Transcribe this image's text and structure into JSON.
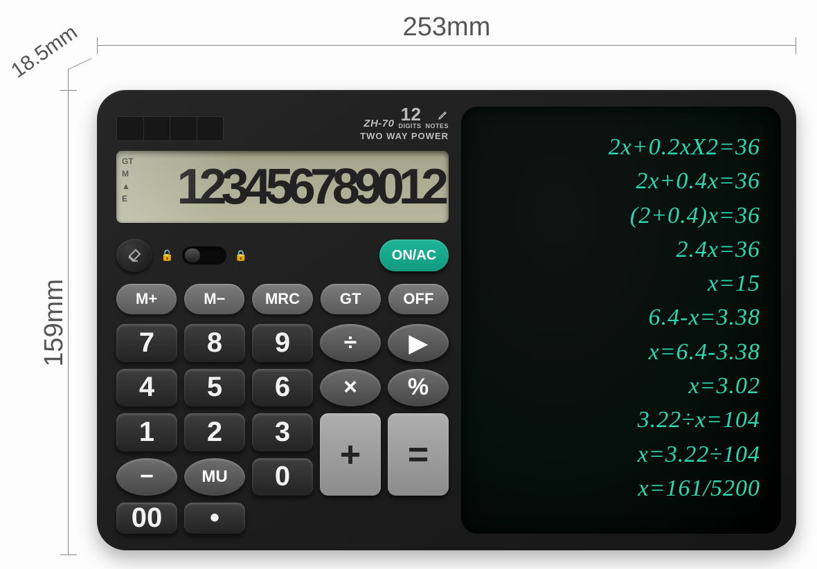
{
  "dimensions": {
    "width": "253mm",
    "height": "159mm",
    "depth": "18.5mm"
  },
  "branding": {
    "model": "ZH-70",
    "digits_number": "12",
    "digits_label": "DIGITS",
    "notes_label": "NOTES",
    "power": "TWO WAY POWER"
  },
  "lcd": {
    "indicators": [
      "GT",
      "M",
      "▲",
      "E"
    ],
    "value": "123456789012",
    "suffix": "-"
  },
  "buttons": {
    "onac": "ON/AC",
    "memory": [
      "M+",
      "M−",
      "MRC",
      "GT",
      "OFF"
    ],
    "grid": {
      "r1": [
        "7",
        "8",
        "9",
        "÷",
        "▶"
      ],
      "r2": [
        "4",
        "5",
        "6",
        "×",
        "%"
      ],
      "r3": [
        "1",
        "2",
        "3",
        "−",
        "MU"
      ],
      "r4": [
        "0",
        "00",
        "•"
      ],
      "plus": "+",
      "equals": "="
    }
  },
  "notes": [
    "2x+0.2xX2=36",
    "2x+0.4x=36",
    "(2+0.4)x=36",
    "2.4x=36",
    "x=15",
    "6.4-x=3.38",
    "x=6.4-3.38",
    "x=3.02",
    "3.22÷x=104",
    "x=3.22÷104",
    "x=161/5200"
  ]
}
